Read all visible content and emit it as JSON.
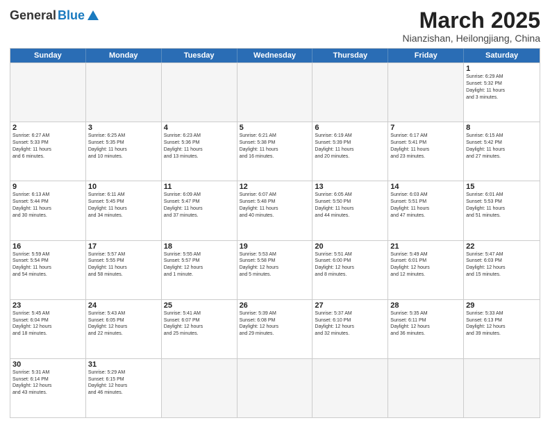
{
  "header": {
    "logo_general": "General",
    "logo_blue": "Blue",
    "month_title": "March 2025",
    "location": "Nianzishan, Heilongjiang, China"
  },
  "weekdays": [
    "Sunday",
    "Monday",
    "Tuesday",
    "Wednesday",
    "Thursday",
    "Friday",
    "Saturday"
  ],
  "rows": [
    [
      {
        "day": "",
        "text": ""
      },
      {
        "day": "",
        "text": ""
      },
      {
        "day": "",
        "text": ""
      },
      {
        "day": "",
        "text": ""
      },
      {
        "day": "",
        "text": ""
      },
      {
        "day": "",
        "text": ""
      },
      {
        "day": "1",
        "text": "Sunrise: 6:29 AM\nSunset: 5:32 PM\nDaylight: 11 hours\nand 3 minutes."
      }
    ],
    [
      {
        "day": "2",
        "text": "Sunrise: 6:27 AM\nSunset: 5:33 PM\nDaylight: 11 hours\nand 6 minutes."
      },
      {
        "day": "3",
        "text": "Sunrise: 6:25 AM\nSunset: 5:35 PM\nDaylight: 11 hours\nand 10 minutes."
      },
      {
        "day": "4",
        "text": "Sunrise: 6:23 AM\nSunset: 5:36 PM\nDaylight: 11 hours\nand 13 minutes."
      },
      {
        "day": "5",
        "text": "Sunrise: 6:21 AM\nSunset: 5:38 PM\nDaylight: 11 hours\nand 16 minutes."
      },
      {
        "day": "6",
        "text": "Sunrise: 6:19 AM\nSunset: 5:39 PM\nDaylight: 11 hours\nand 20 minutes."
      },
      {
        "day": "7",
        "text": "Sunrise: 6:17 AM\nSunset: 5:41 PM\nDaylight: 11 hours\nand 23 minutes."
      },
      {
        "day": "8",
        "text": "Sunrise: 6:15 AM\nSunset: 5:42 PM\nDaylight: 11 hours\nand 27 minutes."
      }
    ],
    [
      {
        "day": "9",
        "text": "Sunrise: 6:13 AM\nSunset: 5:44 PM\nDaylight: 11 hours\nand 30 minutes."
      },
      {
        "day": "10",
        "text": "Sunrise: 6:11 AM\nSunset: 5:45 PM\nDaylight: 11 hours\nand 34 minutes."
      },
      {
        "day": "11",
        "text": "Sunrise: 6:09 AM\nSunset: 5:47 PM\nDaylight: 11 hours\nand 37 minutes."
      },
      {
        "day": "12",
        "text": "Sunrise: 6:07 AM\nSunset: 5:48 PM\nDaylight: 11 hours\nand 40 minutes."
      },
      {
        "day": "13",
        "text": "Sunrise: 6:05 AM\nSunset: 5:50 PM\nDaylight: 11 hours\nand 44 minutes."
      },
      {
        "day": "14",
        "text": "Sunrise: 6:03 AM\nSunset: 5:51 PM\nDaylight: 11 hours\nand 47 minutes."
      },
      {
        "day": "15",
        "text": "Sunrise: 6:01 AM\nSunset: 5:53 PM\nDaylight: 11 hours\nand 51 minutes."
      }
    ],
    [
      {
        "day": "16",
        "text": "Sunrise: 5:59 AM\nSunset: 5:54 PM\nDaylight: 11 hours\nand 54 minutes."
      },
      {
        "day": "17",
        "text": "Sunrise: 5:57 AM\nSunset: 5:55 PM\nDaylight: 11 hours\nand 58 minutes."
      },
      {
        "day": "18",
        "text": "Sunrise: 5:55 AM\nSunset: 5:57 PM\nDaylight: 12 hours\nand 1 minute."
      },
      {
        "day": "19",
        "text": "Sunrise: 5:53 AM\nSunset: 5:58 PM\nDaylight: 12 hours\nand 5 minutes."
      },
      {
        "day": "20",
        "text": "Sunrise: 5:51 AM\nSunset: 6:00 PM\nDaylight: 12 hours\nand 8 minutes."
      },
      {
        "day": "21",
        "text": "Sunrise: 5:49 AM\nSunset: 6:01 PM\nDaylight: 12 hours\nand 12 minutes."
      },
      {
        "day": "22",
        "text": "Sunrise: 5:47 AM\nSunset: 6:03 PM\nDaylight: 12 hours\nand 15 minutes."
      }
    ],
    [
      {
        "day": "23",
        "text": "Sunrise: 5:45 AM\nSunset: 6:04 PM\nDaylight: 12 hours\nand 18 minutes."
      },
      {
        "day": "24",
        "text": "Sunrise: 5:43 AM\nSunset: 6:05 PM\nDaylight: 12 hours\nand 22 minutes."
      },
      {
        "day": "25",
        "text": "Sunrise: 5:41 AM\nSunset: 6:07 PM\nDaylight: 12 hours\nand 25 minutes."
      },
      {
        "day": "26",
        "text": "Sunrise: 5:39 AM\nSunset: 6:08 PM\nDaylight: 12 hours\nand 29 minutes."
      },
      {
        "day": "27",
        "text": "Sunrise: 5:37 AM\nSunset: 6:10 PM\nDaylight: 12 hours\nand 32 minutes."
      },
      {
        "day": "28",
        "text": "Sunrise: 5:35 AM\nSunset: 6:11 PM\nDaylight: 12 hours\nand 36 minutes."
      },
      {
        "day": "29",
        "text": "Sunrise: 5:33 AM\nSunset: 6:13 PM\nDaylight: 12 hours\nand 39 minutes."
      }
    ],
    [
      {
        "day": "30",
        "text": "Sunrise: 5:31 AM\nSunset: 6:14 PM\nDaylight: 12 hours\nand 43 minutes."
      },
      {
        "day": "31",
        "text": "Sunrise: 5:29 AM\nSunset: 6:15 PM\nDaylight: 12 hours\nand 46 minutes."
      },
      {
        "day": "",
        "text": ""
      },
      {
        "day": "",
        "text": ""
      },
      {
        "day": "",
        "text": ""
      },
      {
        "day": "",
        "text": ""
      },
      {
        "day": "",
        "text": ""
      }
    ]
  ]
}
